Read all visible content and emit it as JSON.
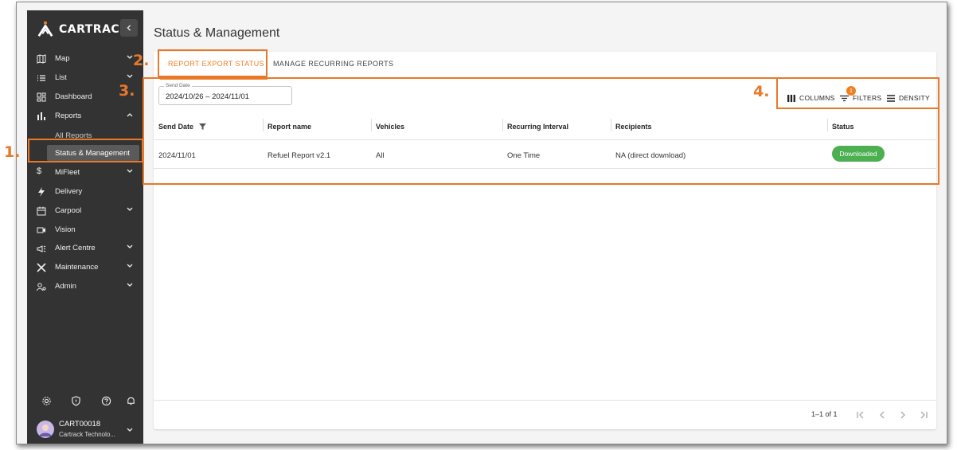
{
  "brand": {
    "name": "CARTRACK",
    "accent": "#f07f22"
  },
  "sidebar": {
    "collapse_icon": "chevron-left-icon",
    "items": [
      {
        "label": "Map",
        "icon": "map-icon",
        "chevron": true
      },
      {
        "label": "List",
        "icon": "list-icon",
        "chevron": true
      },
      {
        "label": "Dashboard",
        "icon": "dashboard-icon",
        "chevron": false
      },
      {
        "label": "Reports",
        "icon": "bar-chart-icon",
        "chevron": true,
        "expanded": true
      },
      {
        "label": "MiFleet",
        "icon": "dollar-icon",
        "chevron": true
      },
      {
        "label": "Delivery",
        "icon": "bolt-icon",
        "chevron": false
      },
      {
        "label": "Carpool",
        "icon": "calendar-icon",
        "chevron": true
      },
      {
        "label": "Vision",
        "icon": "video-icon",
        "chevron": false
      },
      {
        "label": "Alert Centre",
        "icon": "megaphone-icon",
        "chevron": true
      },
      {
        "label": "Maintenance",
        "icon": "tools-icon",
        "chevron": true
      },
      {
        "label": "Admin",
        "icon": "users-admin-icon",
        "chevron": true
      }
    ],
    "sub_items": [
      {
        "label": "All Reports"
      },
      {
        "label": "Status & Management",
        "selected": true
      }
    ],
    "bottom_icons": [
      "settings-icon",
      "shield-icon",
      "help-icon",
      "bell-icon"
    ],
    "user": {
      "name": "CART00018",
      "company": "Cartrack Technolo..."
    }
  },
  "page": {
    "title": "Status & Management"
  },
  "tabs": [
    {
      "label": "REPORT EXPORT STATUS",
      "active": true
    },
    {
      "label": "MANAGE RECURRING REPORTS",
      "active": false
    }
  ],
  "date_filter": {
    "label": "Send Date",
    "value": "2024/10/26 – 2024/11/01"
  },
  "toolbar": {
    "columns_label": "COLUMNS",
    "filters_label": "FILTERS",
    "filters_count": "1",
    "density_label": "DENSITY"
  },
  "table": {
    "columns": [
      "Send Date",
      "Report name",
      "Vehicles",
      "Recurring Interval",
      "Recipients",
      "Status"
    ],
    "rows": [
      {
        "send_date": "2024/11/01",
        "report_name": "Refuel Report v2.1",
        "vehicles": "All",
        "interval": "One Time",
        "recipients": "NA (direct download)",
        "status": "Downloaded"
      }
    ],
    "status_color": "#4caf50"
  },
  "pagination": {
    "info": "1–1 of 1"
  },
  "annotations": [
    {
      "label": "1."
    },
    {
      "label": "2."
    },
    {
      "label": "3."
    },
    {
      "label": "4."
    }
  ],
  "annotation_color": "#e8782a"
}
